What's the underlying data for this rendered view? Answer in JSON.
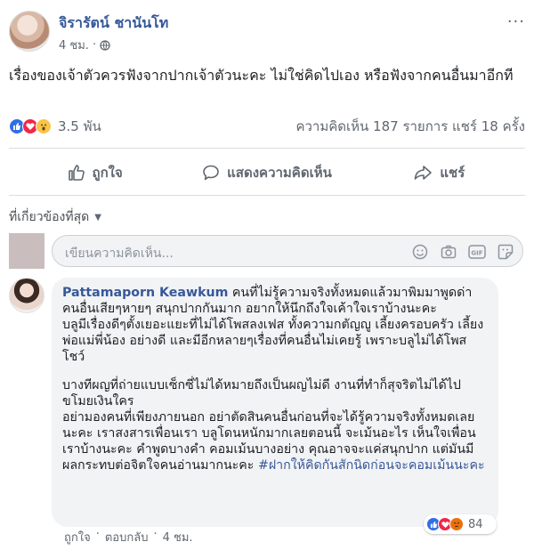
{
  "post": {
    "author": "จิรารัตน์ ชานันโท",
    "time": "4 ชม.",
    "separator": "·",
    "more": "···",
    "text": "เรื่องของเจ้าตัวควรฟังจากปากเจ้าตัวนะคะ ไม่ใช่คิดไปเอง หรือฟังจากคนอื่นมาอีกที",
    "reaction_count": "3.5 พัน",
    "stats": "ความคิดเห็น 187 รายการ  แชร์ 18 ครั้ง"
  },
  "actions": {
    "like": "ถูกใจ",
    "comment": "แสดงความคิดเห็น",
    "share": "แชร์"
  },
  "comments_sort": {
    "label": "ที่เกี่ยวข้องที่สุด",
    "caret": "▼"
  },
  "composer": {
    "placeholder": "เขียนความคิดเห็น...",
    "tools": [
      "emoji-icon",
      "camera-icon",
      "gif-icon",
      "sticker-icon"
    ],
    "gif_label": "GIF"
  },
  "comment": {
    "author": "Pattamaporn Keawkum",
    "paragraph_1": "คนที่ไม่รู้ความจริงทั้งหมดแล้วมาพิมมาพูดด่าคนอื่นเสียๆหายๆ สนุกปากกันมาก อยากให้นึกถึงใจเค้าใจเราบ้างนะคะ",
    "paragraph_2": "บลูมีเรื่องดีๆตั้งเยอะแยะที่ไม่ได้โพสลงเฟส ทั้งความกตัญญู เลี้ยงครอบครัว เลี้ยงพ่อแม่พี่น้อง อย่างดี และมีอีกหลายๆเรื่องที่คนอื่นไม่เคยรู้ เพราะบลูไม่ได้โพสโชว์",
    "paragraph_3": "บางทีผญที่ถ่ายแบบเซ็กซี่ไม่ได้หมายถึงเป็นผญไม่ดี งานที่ทำก็สุจริตไม่ได้ไปขโมยเงินใคร",
    "paragraph_4": "อย่ามองคนที่เพียงภายนอก อย่าตัดสินคนอื่นก่อนที่จะได้รู้ความจริงทั้งหมดเลยนะคะ เราสงสารเพื่อนเรา บลูโดนหนักมากเลยตอนนี้ จะเม้นอะไร เห็นใจเพื่อนเราบ้างนะคะ คำพูดบางคำ คอมเม้นบางอย่าง คุณอาจจะแค่สนุกปาก แต่มันมีผลกระทบต่อจิตใจคนอ่านมากนะคะ",
    "hashtag": "#ฝากให้คิดกันสักนิดก่อนจะคอมเม้นนะคะ",
    "reaction_count": "84",
    "like_link": "ถูกใจ",
    "separator": "·",
    "reply_link": "ตอบกลับ",
    "time": "4 ชม."
  },
  "colors": {
    "link_blue": "#365899",
    "like_blue": "#2f6fe6",
    "love_red": "#f0284a",
    "wow_yellow": "#f7c548",
    "angry_orange": "#e9710f"
  }
}
